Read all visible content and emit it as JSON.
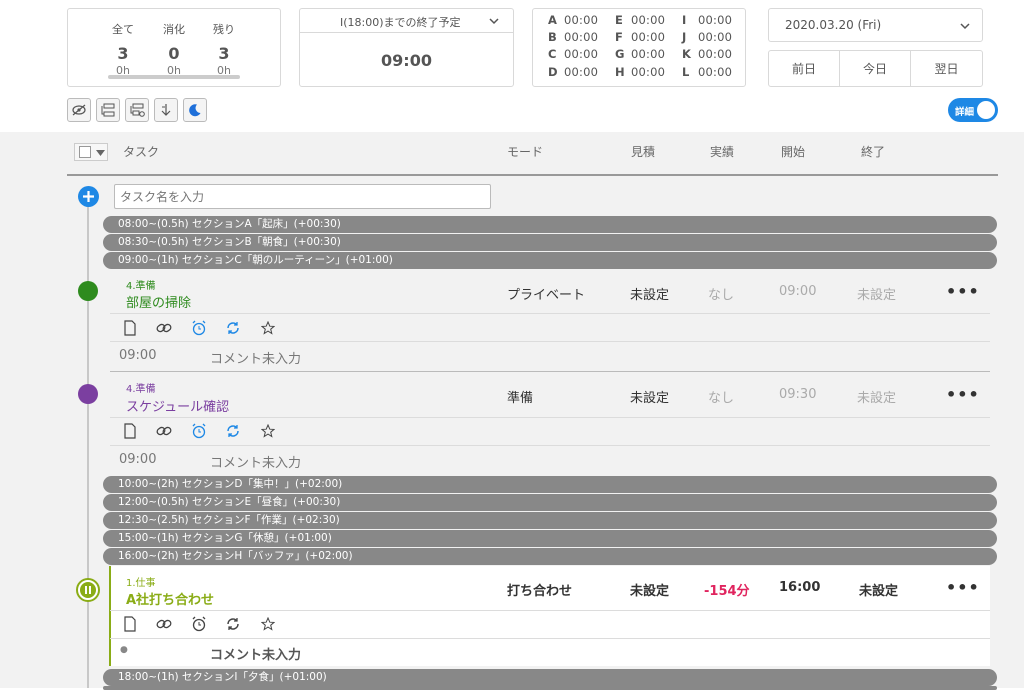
{
  "summary": {
    "labels": [
      "全て",
      "消化",
      "残り"
    ],
    "counts": [
      "3",
      "0",
      "3"
    ],
    "hours": [
      "0h",
      "0h",
      "0h"
    ]
  },
  "forecast": {
    "label": "I(18:00)までの終了予定",
    "value": "09:00"
  },
  "sections_times": [
    {
      "letter": "A",
      "time": "00:00"
    },
    {
      "letter": "B",
      "time": "00:00"
    },
    {
      "letter": "C",
      "time": "00:00"
    },
    {
      "letter": "D",
      "time": "00:00"
    },
    {
      "letter": "E",
      "time": "00:00"
    },
    {
      "letter": "F",
      "time": "00:00"
    },
    {
      "letter": "G",
      "time": "00:00"
    },
    {
      "letter": "H",
      "time": "00:00"
    },
    {
      "letter": "I",
      "time": "00:00"
    },
    {
      "letter": "J",
      "time": "00:00"
    },
    {
      "letter": "K",
      "time": "00:00"
    },
    {
      "letter": "L",
      "time": "00:00"
    }
  ],
  "date": {
    "value": "2020.03.20 (Fri)",
    "prev": "前日",
    "today": "今日",
    "next": "翌日"
  },
  "toggle": {
    "label": "詳細"
  },
  "table_header": {
    "task": "タスク",
    "mode": "モード",
    "estimate": "見積",
    "actual": "実績",
    "start": "開始",
    "end": "終了"
  },
  "new_task": {
    "placeholder": "タスク名を入力"
  },
  "section_bars": [
    "08:00~(0.5h) セクションA「起床」(+00:30)",
    "08:30~(0.5h) セクションB「朝食」(+00:30)",
    "09:00~(1h) セクションC「朝のルーティーン」(+01:00)",
    "10:00~(2h) セクションD「集中！」(+02:00)",
    "12:00~(0.5h) セクションE「昼食」(+00:30)",
    "12:30~(2.5h) セクションF「作業」(+02:30)",
    "15:00~(1h) セクションG「休憩」(+01:00)",
    "16:00~(2h) セクションH「バッファ」(+02:00)",
    "18:00~(1h) セクションI「夕食」(+01:00)"
  ],
  "tasks": [
    {
      "category": "4.準備",
      "name": "部屋の掃除",
      "mode": "プライベート",
      "estimate": "未設定",
      "actual": "なし",
      "start": "09:00",
      "end": "未設定",
      "comment_time": "09:00",
      "comment": "コメント未入力",
      "color": "#2e8b1e"
    },
    {
      "category": "4.準備",
      "name": "スケジュール確認",
      "mode": "準備",
      "estimate": "未設定",
      "actual": "なし",
      "start": "09:30",
      "end": "未設定",
      "comment_time": "09:00",
      "comment": "コメント未入力",
      "color": "#7b3fa0"
    },
    {
      "category": "1.仕事",
      "name": "A社打ち合わせ",
      "mode": "打ち合わせ",
      "estimate": "未設定",
      "actual": "-154分",
      "start": "16:00",
      "end": "未設定",
      "comment_time": "●",
      "comment": "コメント未入力",
      "color": "#8aac16"
    }
  ],
  "menu_label": "•••",
  "colors": {
    "accent": "#1e88e5",
    "running": "#8aac16",
    "negative": "#e0245e"
  }
}
